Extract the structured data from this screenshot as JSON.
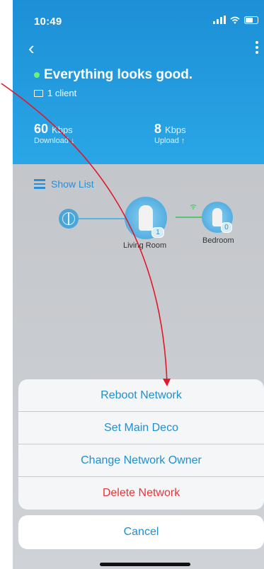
{
  "status_bar": {
    "time": "10:49"
  },
  "header": {
    "status_text": "Everything looks good.",
    "clients": "1 client",
    "download": {
      "value": "60",
      "unit": "Kbps",
      "label": "Download ↓"
    },
    "upload": {
      "value": "8",
      "unit": "Kbps",
      "label": "Upload ↑"
    }
  },
  "topology": {
    "show_list_label": "Show List",
    "nodes": [
      {
        "name": "Living Room",
        "clients": "1"
      },
      {
        "name": "Bedroom",
        "clients": "0"
      }
    ]
  },
  "action_sheet": {
    "items": [
      "Reboot Network",
      "Set Main Deco",
      "Change Network Owner",
      "Delete Network"
    ],
    "cancel": "Cancel"
  },
  "colors": {
    "accent": "#1f8fce",
    "danger": "#e5373a",
    "header": "#1d8fd6"
  }
}
